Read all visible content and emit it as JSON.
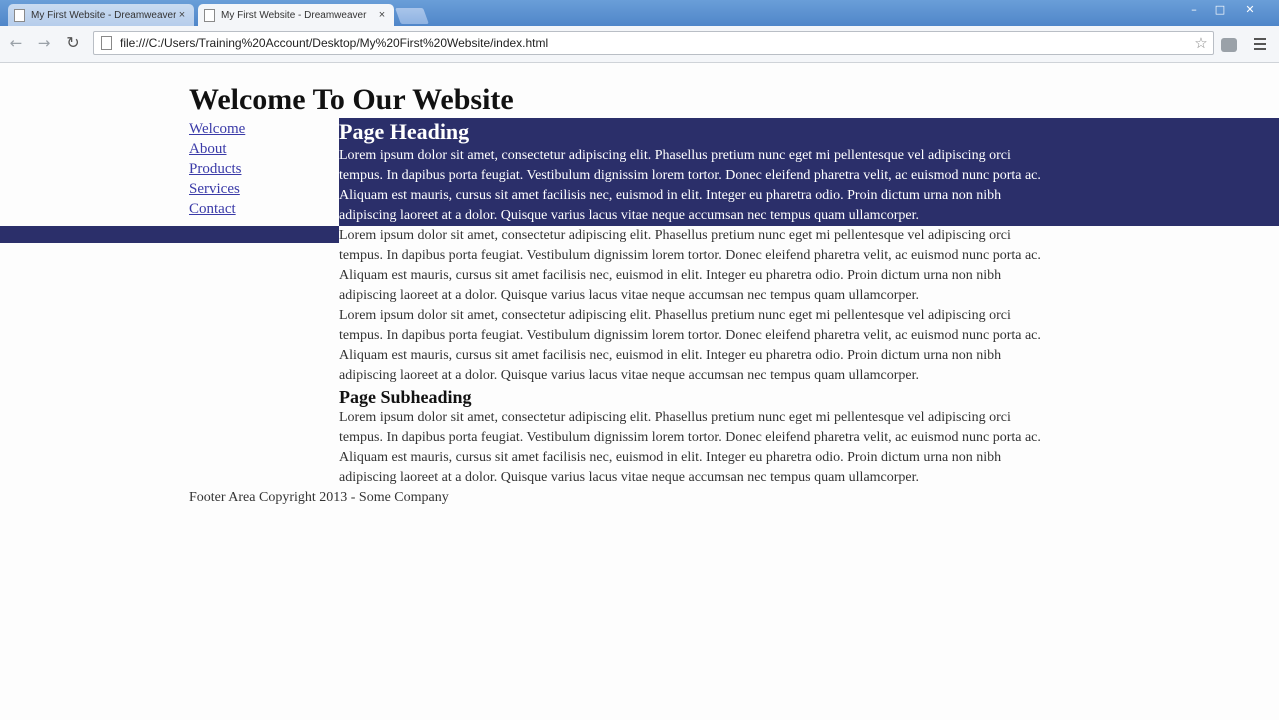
{
  "browser": {
    "tabs": [
      {
        "label": "My First Website - Dreamweaver",
        "close": "×"
      },
      {
        "label": "My First Website - Dreamweaver",
        "close": "×"
      }
    ],
    "window_controls": {
      "minimize": "–",
      "maximize": "□",
      "close": "✕"
    },
    "url": "file:///C:/Users/Training%20Account/Desktop/My%20First%20Website/index.html",
    "icons": {
      "back": "←",
      "forward": "→",
      "reload": "↻",
      "star": "☆"
    }
  },
  "page": {
    "site_title": "Welcome To Our Website",
    "nav": [
      "Welcome",
      "About",
      "Products",
      "Services",
      "Contact"
    ],
    "heading": "Page Heading",
    "para1": [
      "Lorem ipsum dolor sit amet, consectetur adipiscing elit. Phasellus pretium nunc eget mi pellentesque vel adipiscing orci",
      "tempus. In dapibus porta feugiat. Vestibulum dignissim lorem tortor. Donec eleifend pharetra velit, ac euismod nunc porta ac.",
      "Aliquam est mauris, cursus sit amet facilisis nec, euismod in elit. Integer eu pharetra odio. Proin dictum urna non nibh",
      "adipiscing laoreet at a dolor. Quisque varius lacus vitae neque accumsan nec tempus quam ullamcorper."
    ],
    "para2": [
      "Lorem ipsum dolor sit amet, consectetur adipiscing elit. Phasellus pretium nunc eget mi pellentesque vel adipiscing orci",
      "tempus. In dapibus porta feugiat. Vestibulum dignissim lorem tortor. Donec eleifend pharetra velit, ac euismod nunc porta ac.",
      "Aliquam est mauris, cursus sit amet facilisis nec, euismod in elit. Integer eu pharetra odio. Proin dictum urna non nibh",
      "adipiscing laoreet at a dolor. Quisque varius lacus vitae neque accumsan nec tempus quam ullamcorper."
    ],
    "para3": [
      "Lorem ipsum dolor sit amet, consectetur adipiscing elit. Phasellus pretium nunc eget mi pellentesque vel adipiscing orci",
      "tempus. In dapibus porta feugiat. Vestibulum dignissim lorem tortor. Donec eleifend pharetra velit, ac euismod nunc porta ac.",
      "Aliquam est mauris, cursus sit amet facilisis nec, euismod in elit. Integer eu pharetra odio. Proin dictum urna non nibh",
      "adipiscing laoreet at a dolor. Quisque varius lacus vitae neque accumsan nec tempus quam ullamcorper."
    ],
    "subheading": "Page Subheading",
    "para4": [
      "Lorem ipsum dolor sit amet, consectetur adipiscing elit. Phasellus pretium nunc eget mi pellentesque vel adipiscing orci",
      "tempus. In dapibus porta feugiat. Vestibulum dignissim lorem tortor. Donec eleifend pharetra velit, ac euismod nunc porta ac.",
      "Aliquam est mauris, cursus sit amet facilisis nec, euismod in elit. Integer eu pharetra odio. Proin dictum urna non nibh",
      "adipiscing laoreet at a dolor. Quisque varius lacus vitae neque accumsan nec tempus quam ullamcorper."
    ],
    "footer": "Footer Area Copyright 2013 - Some Company"
  },
  "colors": {
    "highlight_band": "#2b2f6a",
    "titlebar": "#5a8fd0",
    "link": "#3a3aa8"
  }
}
